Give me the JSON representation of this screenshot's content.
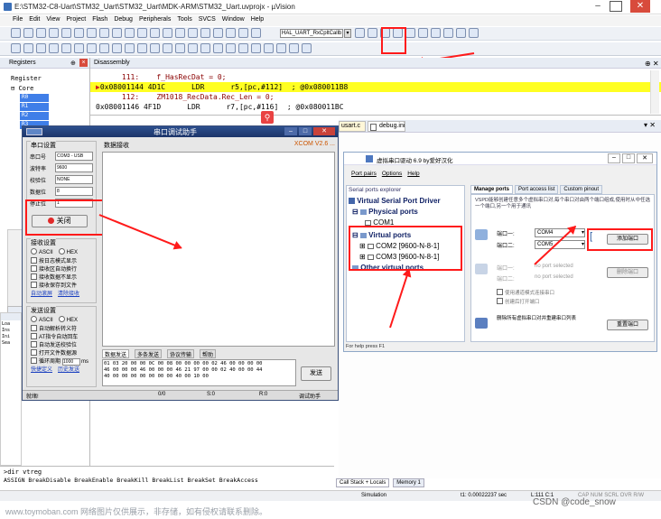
{
  "window": {
    "title": "E:\\STM32-C8-Uart\\STM32_Uart\\STM32_Uart\\MDK-ARM\\STM32_Uart.uvprojx - µVision",
    "menu": [
      "File",
      "Edit",
      "View",
      "Project",
      "Flash",
      "Debug",
      "Peripherals",
      "Tools",
      "SVCS",
      "Window",
      "Help"
    ],
    "toolbar_combo": "HAL_UART_RxCpltCallb"
  },
  "registers_panel": {
    "title": "Registers",
    "header": "Register",
    "core_label": "Core",
    "items": [
      "R0",
      "R1",
      "R2",
      "R3"
    ]
  },
  "disassembly": {
    "title": "Disassembly",
    "lines": [
      {
        "text": "      111:    f_HasRecDat = 0;",
        "style": "src"
      },
      {
        "text": "0x08001144 4D1C      LDR      r5,[pc,#112]  ; @0x080011B8",
        "style": "cur"
      },
      {
        "text": "      112:    ZM1018_RecData.Rec_Len = 0;",
        "style": "src"
      },
      {
        "text": "0x08001146 4F1D      LDR      r7,[pc,#116]  ; @0x080011BC",
        "style": "asm"
      }
    ]
  },
  "editor_tabs": [
    "usart.c",
    "debug.ini"
  ],
  "serial_assistant": {
    "title": "串口调试助手",
    "port_settings_label": "串口设置",
    "fields": [
      {
        "label": "串口号",
        "value": "COM3 - USB"
      },
      {
        "label": "波特率",
        "value": "9600"
      },
      {
        "label": "校验位",
        "value": "NONE"
      },
      {
        "label": "数据位",
        "value": "8"
      },
      {
        "label": "停止位",
        "value": "1"
      }
    ],
    "close_button": "关闭",
    "recv_settings_label": "接收设置",
    "recv_options": [
      "ASCII",
      "HEX",
      "按日志模式显示",
      "接收区自动换行",
      "接收数据不显示",
      "接收保存到文件"
    ],
    "recv_links": [
      "自动滚屏",
      "清除接收"
    ],
    "send_settings_label": "发送设置",
    "send_options": [
      "ASCII",
      "HEX",
      "自动解析转义符",
      "AT指令自动回车",
      "自动发送校验位",
      "打开文件数据源",
      "循环周期"
    ],
    "cycle_value": "1000",
    "cycle_unit": "ms",
    "send_links": [
      "快捷定义",
      "历史发送"
    ],
    "recv_area_title": "数据接收",
    "version": "XCOM V2.6 ...",
    "send_tabs": [
      "数据发送",
      "多条发送",
      "协议传输",
      "帮助"
    ],
    "send_data": "01 03 20 00 00 0C 00 08 00 00 00 00 02 46 00 00 00 00\n46 00 00 00 46 00 00 00 46 21 97 00 00 02 40 00 00 44\n40 00 00 00 00 00 00 00 40 00 10 00",
    "send_button": "发送",
    "status_items": [
      "就绪!",
      "0/0",
      "S:0",
      "R:0",
      "调试助手"
    ]
  },
  "vspd": {
    "title": "虚拟串口驱动 6.9 by爱好汉化",
    "menu": [
      "Port pairs",
      "Options",
      "Help"
    ],
    "explorer_title": "Serial ports explorer",
    "tree": {
      "root": "Virtual Serial Port Driver",
      "physical": "Physical ports",
      "com1": "COM1",
      "virtual": "Virtual ports",
      "com2": "COM2 [9600-N-8-1]",
      "com3": "COM3 [9600-N-8-1]",
      "other": "Other virtual ports"
    },
    "tabs": [
      "Manage ports",
      "Port access list",
      "Custom pinout"
    ],
    "description": "VSPD能够创建任意多个虚拟串口对,每个串口对由两个端口组成,使用时从中任选一个端口,另一个用于通讯",
    "port1_label": "端口一:",
    "port1_value": "COM4",
    "port2_label": "端口二:",
    "port2_value": "COM5",
    "add_pair_button": "添加端口",
    "pair_label_1": "端口一:",
    "pair_label_2": "端口二:",
    "no_port_selected_1": "no port selected",
    "no_port_selected_2": "no port selected",
    "delete_button": "删除端口",
    "checkbox_1": "使用通道模式连接串口",
    "checkbox_2": "创建后打开端口",
    "reset_text": "删除所有虚拟串口对并重建串口列表",
    "reset_button": "重置端口",
    "status": "For help press F1"
  },
  "command": {
    "prompt": ">dir vtreg",
    "help": "ASSIGN BreakDisable BreakEnable BreakKill BreakList BreakSet BreakAccess"
  },
  "bottom_tabs": [
    "Call Stack + Locals",
    "Memory 1"
  ],
  "status_bar": {
    "mode": "Simulation",
    "time": "t1: 0.00022237 sec",
    "pos": "L:111 C:1",
    "caps": "CAP NUM SCRL OVR R/W"
  },
  "watermark": "www.toymoban.com 网络图片仅供展示，非存储，如有侵权请联系删除。",
  "csdn": "CSDN @code_snow"
}
